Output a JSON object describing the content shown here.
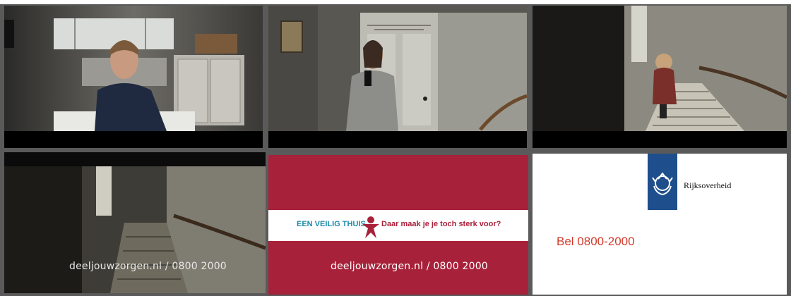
{
  "frames": {
    "f4": {
      "caption": "deeljouwzorgen.nl / 0800 2000"
    },
    "f5": {
      "campaign_part1": "EEN VEILIG THUIS",
      "campaign_part2": "Daar maak je je toch sterk voor?",
      "caption": "deeljouwzorgen.nl / 0800 2000"
    },
    "f6": {
      "org_name": "Rijksoverheid",
      "phone": "Bel 0800-2000"
    }
  },
  "colors": {
    "campaign_red": "#a8213a",
    "campaign_blue": "#1c8ba8",
    "gov_blue": "#1f4e8c",
    "phone_red": "#d23a2a"
  }
}
